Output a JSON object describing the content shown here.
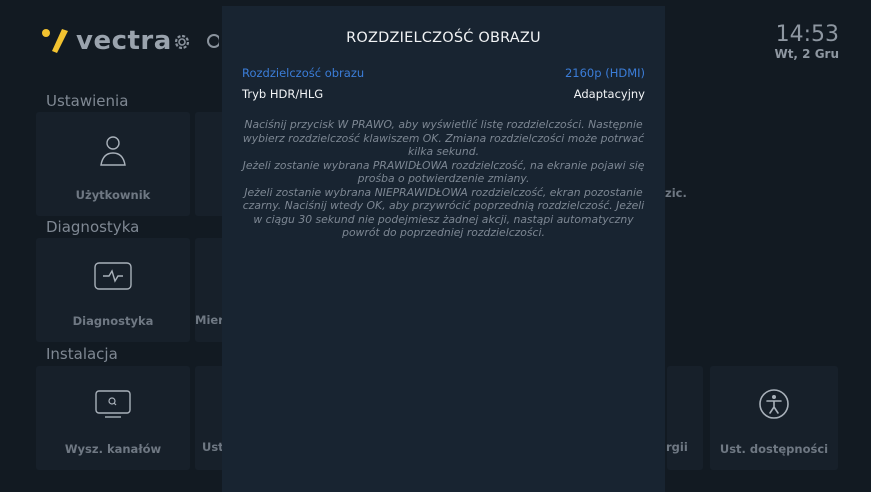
{
  "header": {
    "brand": "vectra",
    "time": "14:53",
    "date": "Wt, 2 Gru"
  },
  "sections": {
    "settings": {
      "title": "Ustawienia",
      "tiles": [
        "Użytkownik"
      ],
      "partial_right": "zic."
    },
    "diagnostics": {
      "title": "Diagnostyka",
      "tiles": [
        "Diagnostyka"
      ],
      "partial_left": "Mier"
    },
    "install": {
      "title": "Instalacja",
      "tiles": [
        "Wysz. kanałów",
        "Ust. dostępności"
      ],
      "partial_left": "Ust",
      "partial_right": "rgii"
    }
  },
  "modal": {
    "title": "ROZDZIELCZOŚĆ OBRAZU",
    "options": [
      {
        "label": "Rozdzielczość obrazu",
        "value": "2160p (HDMI)",
        "selected": true
      },
      {
        "label": "Tryb HDR/HLG",
        "value": "Adaptacyjny",
        "selected": false
      }
    ],
    "description_lines": [
      "Naciśnij przycisk W PRAWO, aby wyświetlić listę rozdzielczości. Następnie",
      "wybierz rozdzielczość klawiszem OK. Zmiana rozdzielczości może potrwać",
      "kilka sekund.",
      "Jeżeli zostanie wybrana PRAWIDŁOWA rozdzielczość, na ekranie pojawi się",
      "prośba o potwierdzenie zmiany.",
      "Jeżeli zostanie wybrana NIEPRAWIDŁOWA rozdzielczość, ekran pozostanie",
      "czarny. Naciśnij wtedy OK, aby przywrócić poprzednią rozdzielczość. Jeżeli",
      "w ciągu 30 sekund nie podejmiesz żadnej akcji, nastąpi automatyczny",
      "powrót do poprzedniej rozdzielczości."
    ]
  },
  "colors": {
    "background": "#121a22",
    "modal": "#182431",
    "accent_selected": "#3b7dd8",
    "logo_yellow": "#f2c230"
  }
}
